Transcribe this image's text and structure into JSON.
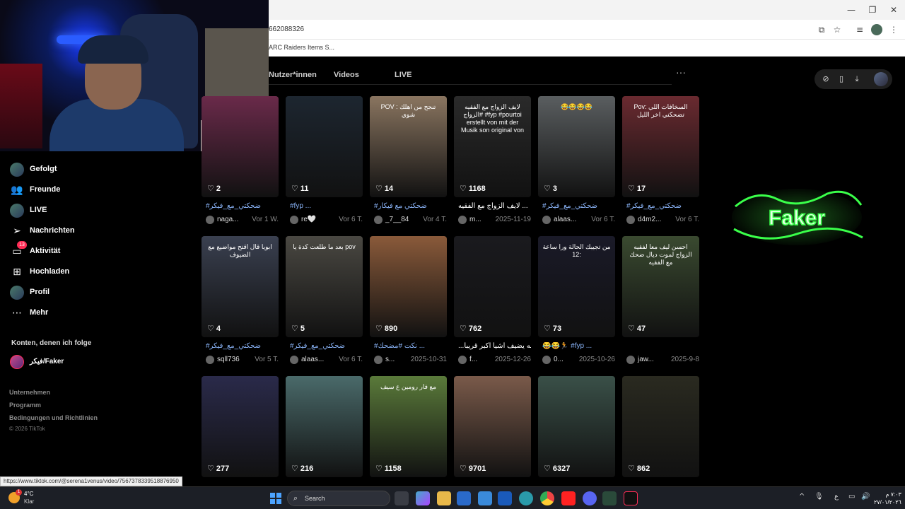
{
  "browser": {
    "url": "662088326",
    "bookmark": "ARC Raiders Items S..."
  },
  "tabs": [
    {
      "label": "Nutzer*innen"
    },
    {
      "label": "Videos"
    },
    {
      "label": "LIVE"
    }
  ],
  "more_label": "···",
  "sidebar": {
    "items": [
      {
        "label": "Gefolgt",
        "icon": "following-icon"
      },
      {
        "label": "Freunde",
        "icon": "friends-icon"
      },
      {
        "label": "LIVE",
        "icon": "live-icon"
      },
      {
        "label": "Nachrichten",
        "icon": "messages-icon"
      },
      {
        "label": "Aktivität",
        "icon": "activity-icon",
        "badge": "13"
      },
      {
        "label": "Hochladen",
        "icon": "upload-icon"
      },
      {
        "label": "Profil",
        "icon": "profile-icon"
      },
      {
        "label": "Mehr",
        "icon": "more-icon"
      }
    ],
    "following_title": "Konten, denen ich folge",
    "following_account": "فيكر/Faker",
    "footer": [
      "Unternehmen",
      "Programm",
      "Bedingungen und Richtlinien"
    ],
    "copyright": "© 2026 TikTok"
  },
  "videos": [
    {
      "likes": "2",
      "caption": "#ضحكتي_مع_فيكر",
      "user": "naga...",
      "date": "Vor 1 W.",
      "bg": "#6a2a4a"
    },
    {
      "likes": "11",
      "caption": "#fyp ...",
      "user": "re🤍",
      "date": "Vor 6 T.",
      "bg": "#1d2630"
    },
    {
      "likes": "14",
      "caption": "#ضحكتي مع فيكار",
      "user": "_7__84",
      "date": "Vor 4 T.",
      "bg": "#8a7560",
      "overlay": "POV : تنجح من اهلك شوي"
    },
    {
      "likes": "1168",
      "caption": "لايف الزواج مع الفقيه ...",
      "user": "m...",
      "date": "2025-11-19",
      "bg": "#2a2a2a",
      "overlay": "لايف الزواج مع الفقيه #الزواج #fyp #pourtoi erstellt von mit der Musik son original von"
    },
    {
      "likes": "3",
      "caption": "#ضحكتي_مع_فيكر",
      "user": "alaas...",
      "date": "Vor 6 T.",
      "bg": "#5a5e60",
      "overlay": "😂😂😂😂"
    },
    {
      "likes": "17",
      "caption": "#ضحكتي_مع_فيكر",
      "user": "d4m2...",
      "date": "Vor 6 T.",
      "bg": "#6a2a30",
      "overlay": "Pov: السخافات اللي تضحكني اخر الليل"
    },
    {
      "likes": "4",
      "caption": "#ضحكتي_مع_فيكر",
      "user": "sqll736",
      "date": "Vor 5 T.",
      "bg": "#3a4050",
      "overlay": "ابويا قال اقتح مواضيع مع الضيوف"
    },
    {
      "likes": "5",
      "caption": "#ضحكتي_مع_فيكر",
      "user": "alaas...",
      "date": "Vor 6 T.",
      "bg": "#4a4842",
      "overlay": "بعد ما طلعت كدة يا pov"
    },
    {
      "likes": "890",
      "caption": "#نكت #مضحك ...",
      "user": "s...",
      "date": "2025-10-31",
      "bg": "#8a5a3a"
    },
    {
      "likes": "762",
      "caption": "...الله يضيف أشيا أكبر قريبا",
      "user": "f...",
      "date": "2025-12-26",
      "bg": "#1a1a1e"
    },
    {
      "likes": "73",
      "caption": "😂😂🏃 #fyp ...",
      "user": "0...",
      "date": "2025-10-26",
      "bg": "#1a1a28",
      "overlay": "من تجيبك الحالة ورا ساعة 12:"
    },
    {
      "likes": "47",
      "caption": "",
      "user": "jaw...",
      "date": "2025-9-8",
      "bg": "#3a4a30",
      "overlay": "احسن ليف معا لفقيه الزواج لموت ديال ضحك مع الفقيه"
    },
    {
      "likes": "277",
      "caption": "",
      "user": "",
      "date": "",
      "bg": "#2a2a4a"
    },
    {
      "likes": "216",
      "caption": "",
      "user": "",
      "date": "",
      "bg": "#4a6a6a"
    },
    {
      "likes": "1158",
      "caption": "",
      "user": "",
      "date": "",
      "bg": "#5a7a3a",
      "overlay": "مع فار رومين ع سيف"
    },
    {
      "likes": "9701",
      "caption": "",
      "user": "",
      "date": "",
      "bg": "#7a5a4a"
    },
    {
      "likes": "6327",
      "caption": "",
      "user": "",
      "date": "",
      "bg": "#3a5048"
    },
    {
      "likes": "862",
      "caption": "",
      "user": "",
      "date": "",
      "bg": "#2a2a20"
    }
  ],
  "logo_text": "Faker",
  "status_url": "https://www.tiktok.com/@serena1venus/video/7567378339518876950",
  "taskbar": {
    "temp": "4°C",
    "weather": "Klar",
    "weather_badge": "1",
    "search_placeholder": "Search",
    "tray_lang": "ع",
    "time": "٧:٠٣ م",
    "date": "٢٧/٠١/٢٠٢٦"
  },
  "colors": {
    "accent": "#fe2c55",
    "hashtag": "#8ab4f8",
    "logo_green": "#3aff4a"
  }
}
